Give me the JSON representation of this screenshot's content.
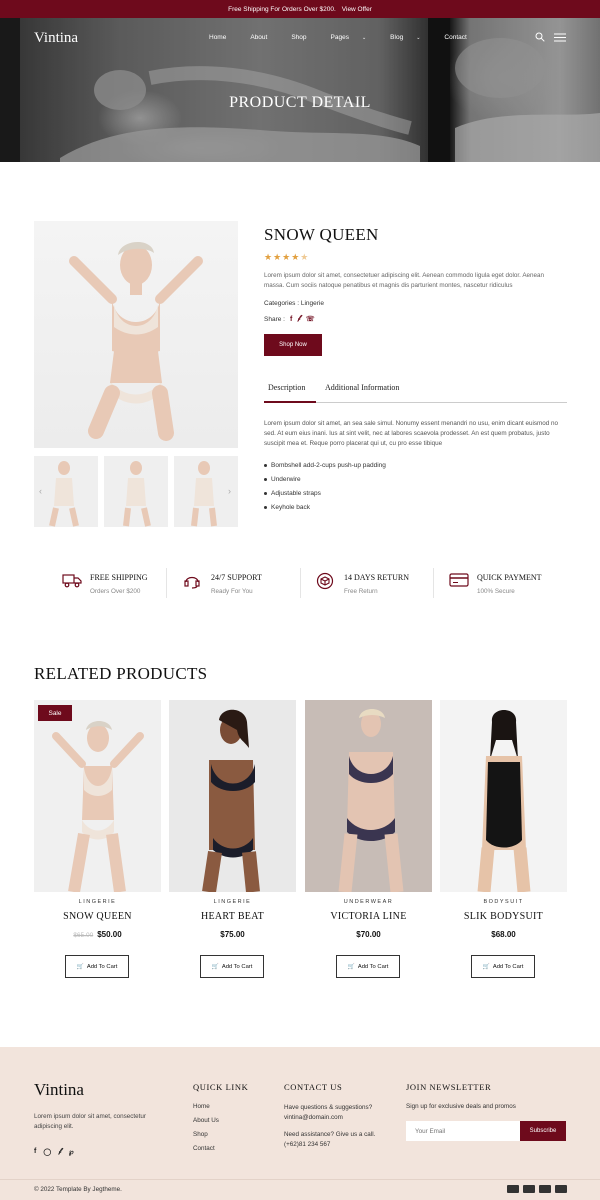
{
  "topbar": {
    "text": "Free Shipping For Orders Over $200.",
    "link": "View Offer"
  },
  "header": {
    "logo": "Vintina",
    "menu": [
      {
        "label": "Home"
      },
      {
        "label": "About"
      },
      {
        "label": "Shop"
      },
      {
        "label": "Pages",
        "dropdown": true
      },
      {
        "label": "Blog",
        "dropdown": true
      },
      {
        "label": "Contact"
      }
    ],
    "page_title": "PRODUCT DETAIL"
  },
  "product": {
    "title": "SNOW QUEEN",
    "rating": 4.5,
    "rating_max": 5,
    "description": "Lorem ipsum dolor sit amet, consectetuer adipiscing elit. Aenean commodo ligula eget dolor. Aenean massa. Cum sociis natoque penatibus et magnis dis parturient montes, nascetur ridiculus",
    "categories_label": "Categories :",
    "categories_value": "Lingerie",
    "share_label": "Share :",
    "cta": "Shop Now",
    "tabs": [
      "Description",
      "Additional Information"
    ],
    "active_tab": "Description",
    "tab_text": "Lorem ipsum dolor sit amet, an sea sale simul. Nonumy essent menandri no usu, enim dicant euismod no sed. At eum eius inani. Ius at sint velit, nec at labores scaevola prodesset. An est quem probatus, justo suscipit mea et. Reque porro placerat qui ut, cu pro esse tibique",
    "features": [
      "Bombshell add-2-cups push-up padding",
      "Underwire",
      "Adjustable straps",
      "Keyhole back"
    ]
  },
  "services": [
    {
      "icon": "truck-icon",
      "title": "FREE SHIPPING",
      "subtitle": "Orders Over $200"
    },
    {
      "icon": "headset-icon",
      "title": "24/7 SUPPORT",
      "subtitle": "Ready For You"
    },
    {
      "icon": "return-box-icon",
      "title": "14 DAYS RETURN",
      "subtitle": "Free Return"
    },
    {
      "icon": "credit-card-icon",
      "title": "QUICK PAYMENT",
      "subtitle": "100% Secure"
    }
  ],
  "related": {
    "title": "RELATED PRODUCTS",
    "sale_badge": "Sale",
    "cart_label": "Add To Cart",
    "items": [
      {
        "category": "LINGERIE",
        "name": "SNOW QUEEN",
        "old_price": "$65.00",
        "price": "$50.00"
      },
      {
        "category": "LINGERIE",
        "name": "HEART BEAT",
        "price": "$75.00"
      },
      {
        "category": "UNDERWEAR",
        "name": "VICTORIA LINE",
        "price": "$70.00"
      },
      {
        "category": "BODYSUIT",
        "name": "SLIK BODYSUIT",
        "price": "$68.00"
      }
    ]
  },
  "footer": {
    "logo": "Vintina",
    "about": "Lorem ipsum dolor sit amet, consectetur adipiscing elit.",
    "quick_link_title": "QUICK LINK",
    "links": [
      "Home",
      "About Us",
      "Shop",
      "Contact"
    ],
    "contact_title": "CONTACT US",
    "contact_q": "Have questions & suggestions?",
    "contact_email": "vintina@domain.com",
    "contact_help": "Need assistance? Give us a call.",
    "contact_phone": "(+62)81 234 567",
    "newsletter_title": "JOIN NEWSLETTER",
    "newsletter_text": "Sign up for exclusive deals and promos",
    "email_placeholder": "Your Email",
    "subscribe": "Subscribe",
    "copyright": "© 2022 Template By Jegtheme.",
    "payment_icons": [
      "mastercard-icon",
      "paypal-icon",
      "visa-icon",
      "card-icon"
    ]
  },
  "colors": {
    "brand": "#6e0a1c",
    "star": "#e2a03f",
    "footer_bg": "#f2e4dc"
  }
}
